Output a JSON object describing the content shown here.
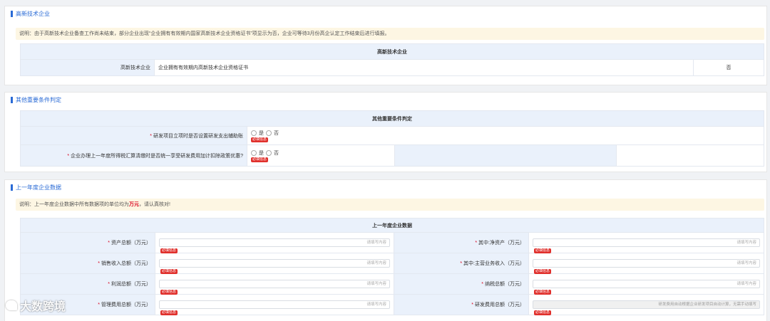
{
  "s1": {
    "title": "高新技术企业",
    "notice": "说明：由于高新技术企业备查工作尚未结束，部分企业出现“企业拥有有效期内国家高新技术企业资格证书”项显示为否，企业可等待3月份高企认定工作结束后进行填报。",
    "table_head": "高新技术企业",
    "row_label": "高新技术企业",
    "row_desc": "企业拥有有效期内高新技术企业资格证书",
    "row_value": "否"
  },
  "s2": {
    "title": "其他重要条件判定",
    "table_head": "其他重要条件判定",
    "rows": [
      {
        "label": "研发项目立项时是否设置研发支出辅助账",
        "yes": "是",
        "no": "否",
        "must": "必填信息"
      },
      {
        "label": "企业办理上一年度所得税汇算清缴时是否统一享受研发费用加计扣除政策优惠?",
        "yes": "是",
        "no": "否",
        "must": "必填信息"
      }
    ]
  },
  "s3": {
    "title": "上一年度企业数据",
    "notice_pre": "说明：上一年度企业数据中所有数据项的单位均为",
    "notice_em": "万元",
    "notice_post": "，请认真核对!",
    "table_head": "上一年度企业数据",
    "placeholder": "请填写内容",
    "must": "必填信息",
    "rows": [
      {
        "l1": "资产总额（万元）",
        "l2": "其中:净资产（万元）"
      },
      {
        "l1": "销售收入总额（万元）",
        "l2": "其中:主营业务收入（万元）"
      },
      {
        "l1": "利润总额（万元）",
        "l2": "纳税总额（万元）"
      },
      {
        "l1": "管理费用总额（万元）",
        "l2": "研发费用总额（万元）"
      }
    ],
    "rd_auto_note": "研发费用自动根据企业研发项目自动计算，无需手动填写"
  },
  "watermark": "大数跨境"
}
